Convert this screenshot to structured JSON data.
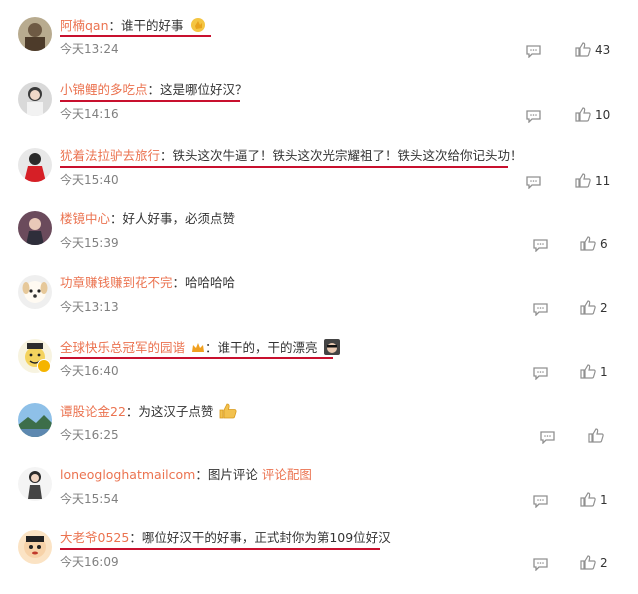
{
  "comments": [
    {
      "user": "阿楠qan",
      "sep": "：",
      "text": "谁干的好事",
      "link": "",
      "time": "今天13:24",
      "likes": "43",
      "avatar": "avatar-portrait-icon",
      "emoji": "hand-emoji-icon"
    },
    {
      "user": "小锦鲤的多吃点",
      "sep": "：",
      "text": "这是哪位好汉？",
      "link": "",
      "time": "今天14:16",
      "likes": "10",
      "avatar": "avatar-girl-icon",
      "emoji": ""
    },
    {
      "user": "犹着法拉驴去旅行",
      "sep": "：",
      "text": "铁头这次牛逼了！铁头这次光宗耀祖了！铁头这次给你记头功！",
      "link": "",
      "time": "今天15:40",
      "likes": "11",
      "avatar": "avatar-red-icon",
      "emoji": ""
    },
    {
      "user": "楼镜中心",
      "sep": "：",
      "text": "好人好事，必须点赞",
      "link": "",
      "time": "今天15:39",
      "likes": "6",
      "avatar": "avatar-woman-icon",
      "emoji": ""
    },
    {
      "user": "功章赚钱赚到花不完",
      "sep": "：",
      "text": "哈哈哈哈",
      "link": "",
      "time": "今天13:13",
      "likes": "2",
      "avatar": "avatar-dog-icon",
      "emoji": ""
    },
    {
      "user": "全球快乐总冠军的园谐",
      "sep": "：",
      "text": "谁干的，干的漂亮",
      "link": "",
      "time": "今天16:40",
      "likes": "1",
      "avatar": "avatar-cartoon-icon",
      "emoji": "cool-emoji-icon"
    },
    {
      "user": "谭股论金22",
      "sep": "：",
      "text": "为这汉子点赞",
      "link": "",
      "time": "今天16:25",
      "likes": "",
      "avatar": "avatar-landscape-icon",
      "emoji": "thumbs-up-emoji-icon"
    },
    {
      "user": "loneogloghatmailcom",
      "sep": "：",
      "text": "图片评论 ",
      "link": "评论配图",
      "time": "今天15:54",
      "likes": "1",
      "avatar": "avatar-figure-icon",
      "emoji": ""
    },
    {
      "user": "大老爷0525",
      "sep": "：",
      "text": "哪位好汉干的好事，正式封你为第109位好汉",
      "link": "",
      "time": "今天16:09",
      "likes": "2",
      "avatar": "avatar-crayon-icon",
      "emoji": ""
    }
  ]
}
